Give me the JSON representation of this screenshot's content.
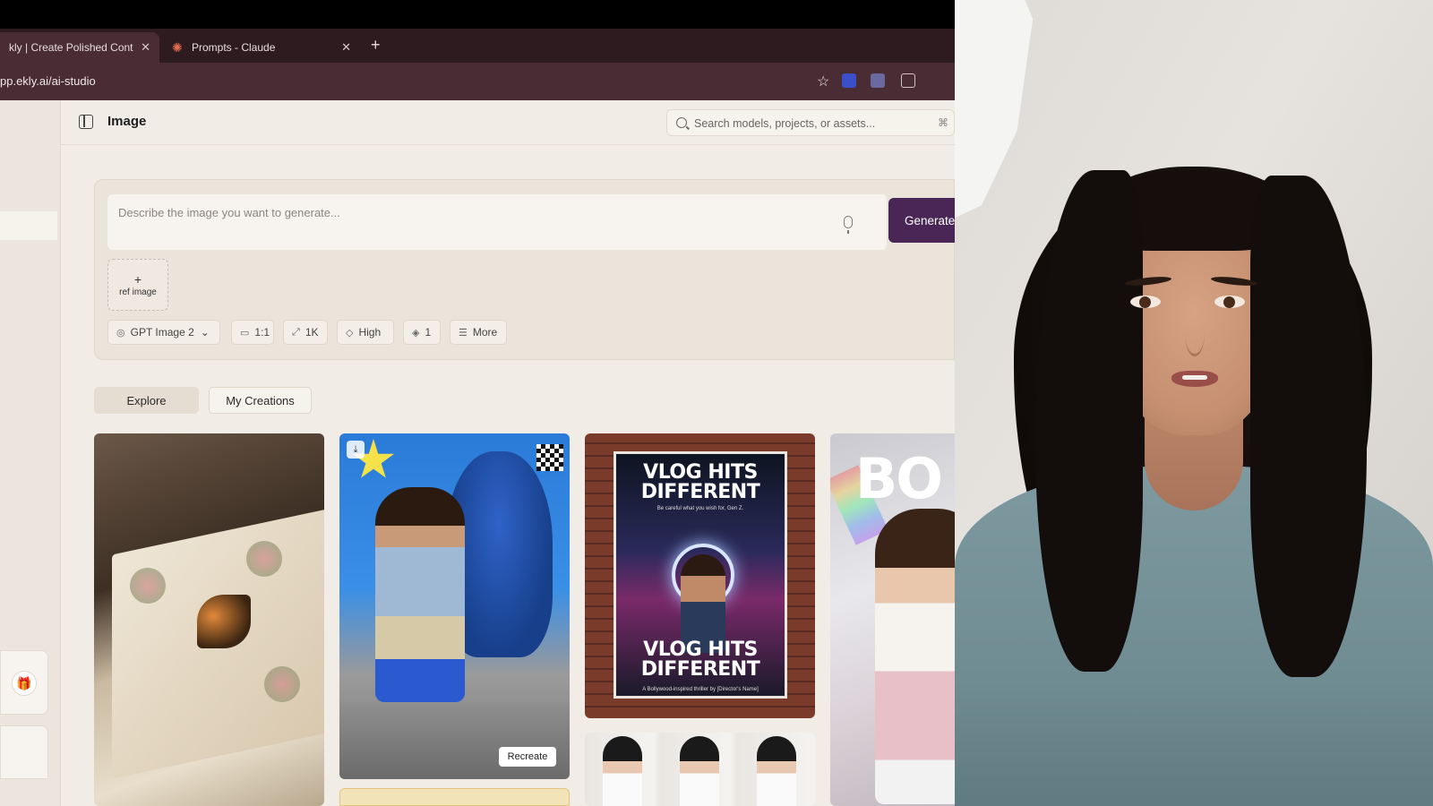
{
  "browser": {
    "tabs": [
      {
        "label": "kly | Create Polished Conten",
        "close": "✕"
      },
      {
        "label": "Prompts - Claude",
        "close": "✕"
      }
    ],
    "new_tab": "+",
    "url": "pp.ekly.ai/ai-studio"
  },
  "header": {
    "title": "Image",
    "search_placeholder": "Search models, projects, or assets...",
    "search_shortcut": "⌘"
  },
  "composer": {
    "prompt_placeholder": "Describe the image you want to generate...",
    "generate_label": "Generate",
    "ref_plus": "+",
    "ref_label": "ref image",
    "options": [
      {
        "icon": "◎",
        "label": "GPT Image 2",
        "caret": "⌄"
      },
      {
        "icon": "▭",
        "label": "1:1"
      },
      {
        "icon": "⤢",
        "label": "1K"
      },
      {
        "icon": "◇",
        "label": "High"
      },
      {
        "icon": "◈",
        "label": "1"
      },
      {
        "icon": "☰",
        "label": "More"
      }
    ]
  },
  "view_tabs": {
    "explore": "Explore",
    "my_creations": "My Creations"
  },
  "gallery": {
    "recreate_label": "Recreate",
    "poster_title": "VLOG HITS DIFFERENT",
    "poster_tagline": "Be careful what you wish for, Gen Z.",
    "poster_bottom_title": "VLOG HITS DIFFERENT",
    "poster_credit": "A Bollywood-inspired thriller by [Director's Name]",
    "partial_headline": "BO"
  }
}
